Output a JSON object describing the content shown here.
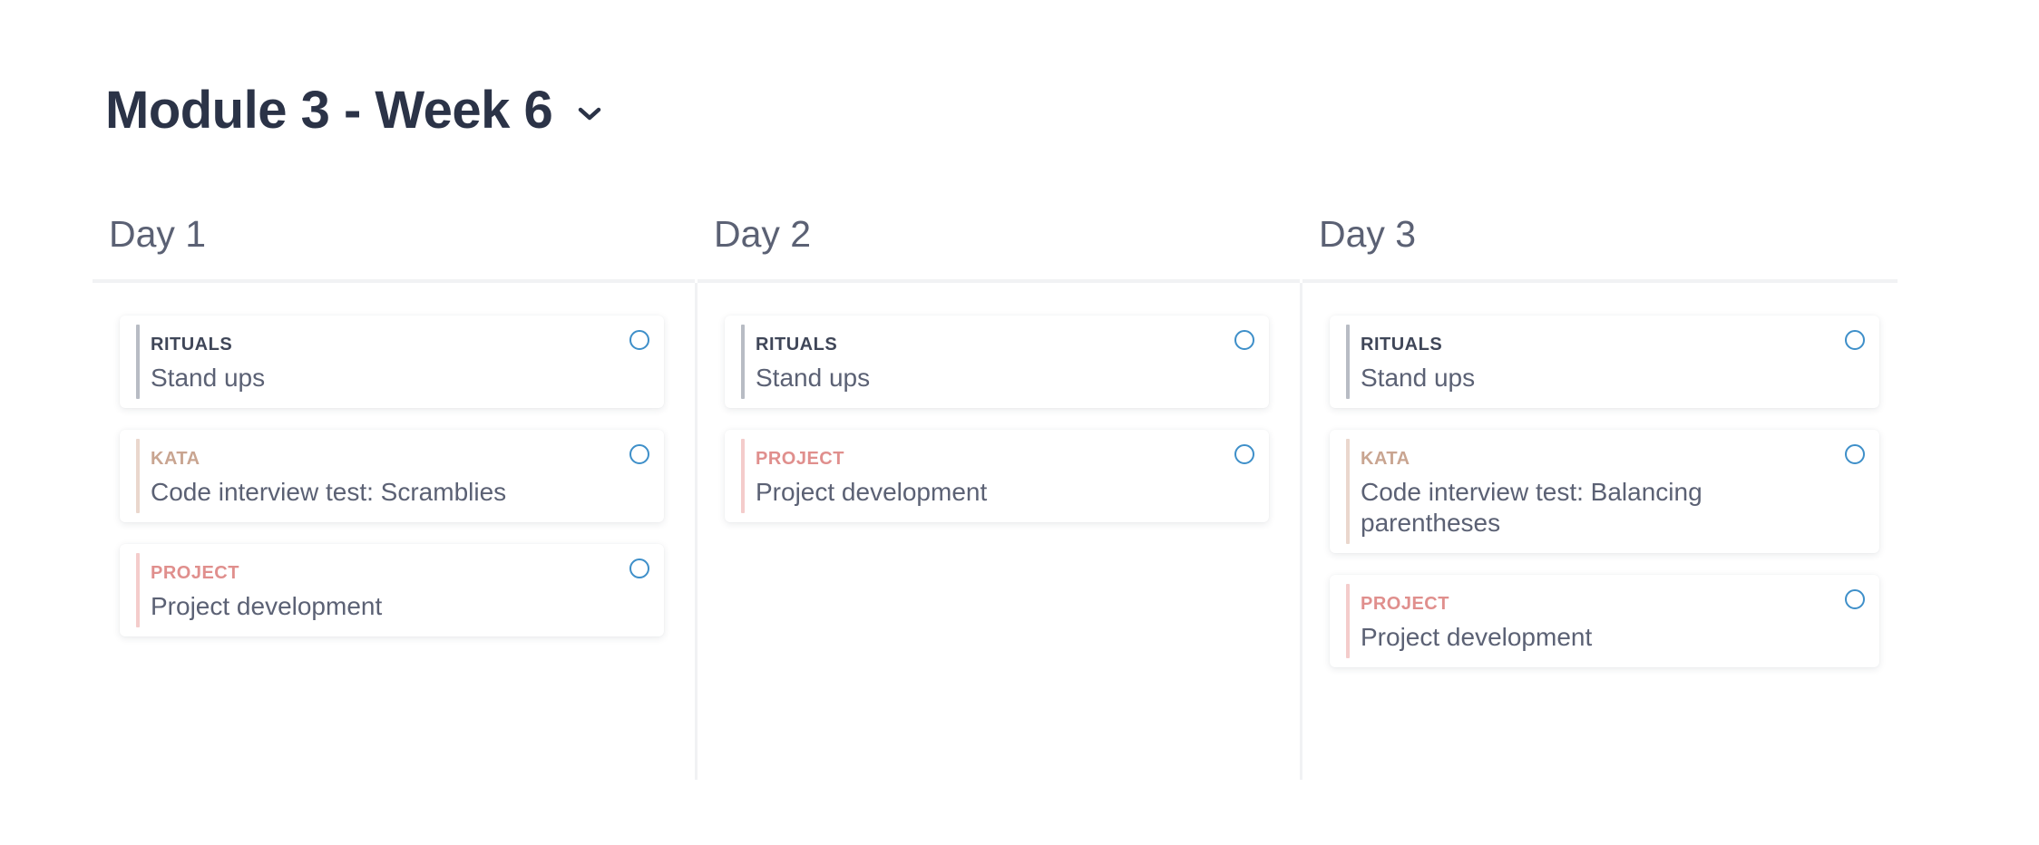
{
  "header": {
    "title": "Module 3 - Week 6",
    "dropdown_icon": "chevron-down-icon"
  },
  "colors": {
    "title": "#2b3347",
    "day_heading": "#5b6174",
    "rituals": "#3f4658",
    "kata": "#c9a591",
    "project": "#e08f8d",
    "checkbox": "#3e8fc9"
  },
  "days": [
    {
      "heading": "Day 1",
      "cards": [
        {
          "category": "RITUALS",
          "title": "Stand ups",
          "done": false
        },
        {
          "category": "KATA",
          "title": "Code interview test: Scramblies",
          "done": false
        },
        {
          "category": "PROJECT",
          "title": "Project development",
          "done": false
        }
      ]
    },
    {
      "heading": "Day 2",
      "cards": [
        {
          "category": "RITUALS",
          "title": "Stand ups",
          "done": false
        },
        {
          "category": "PROJECT",
          "title": "Project development",
          "done": false
        }
      ]
    },
    {
      "heading": "Day 3",
      "cards": [
        {
          "category": "RITUALS",
          "title": "Stand ups",
          "done": false
        },
        {
          "category": "KATA",
          "title": "Code interview test: Balancing parentheses",
          "done": false
        },
        {
          "category": "PROJECT",
          "title": "Project development",
          "done": false
        }
      ]
    }
  ]
}
